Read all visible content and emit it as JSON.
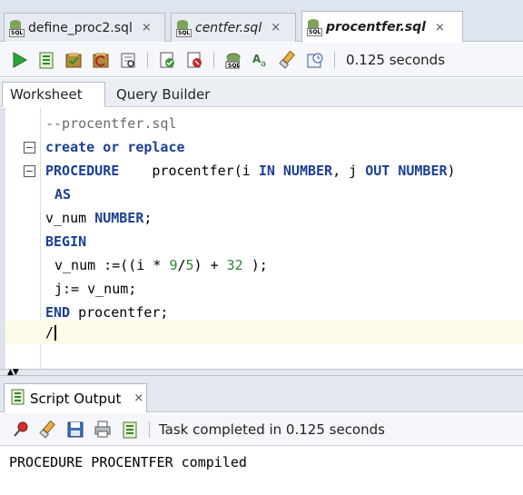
{
  "editor_tabs": [
    {
      "label": "define_proc2.sql",
      "style": "normal",
      "close": "×"
    },
    {
      "label": "centfer.sql",
      "style": "italic",
      "close": "×"
    },
    {
      "label": "procentfer.sql",
      "style": "bold-italic",
      "close": "×",
      "active": true
    }
  ],
  "toolbar": {
    "buttons": [
      "run-statement-icon",
      "run-script-icon",
      "commit-icon",
      "rollback-icon",
      "autotrace-icon",
      "explain-plan-icon",
      "sql-tuning-icon",
      "unshared-sql-icon",
      "format-icon",
      "clear-icon",
      "history-icon"
    ],
    "status": "0.125 seconds"
  },
  "worksheet_tabs": [
    {
      "label": "Worksheet",
      "active": true
    },
    {
      "label": "Query Builder",
      "active": false
    }
  ],
  "code": {
    "l1": "--procentfer.sql",
    "l2_kw1": "create",
    "l2_kw2": "or",
    "l2_kw3": "replace",
    "l3_kw": "PROCEDURE",
    "l3_name": "procentfer(i ",
    "l3_in": "IN",
    "l3_type1": "NUMBER",
    "l3_mid": ", j ",
    "l3_out": "OUT",
    "l3_type2": "NUMBER",
    "l3_end": ")",
    "l4_kw": "AS",
    "l5_var": "v_num ",
    "l5_type": "NUMBER",
    "l5_end": ";",
    "l6_kw": "BEGIN",
    "l7_a": "v_num :=((i * ",
    "l7_n1": "9",
    "l7_b": "/",
    "l7_n2": "5",
    "l7_c": ") + ",
    "l7_n3": "32",
    "l7_d": " );",
    "l8": "j:= v_num;",
    "l9_kw": "END",
    "l9_rest": " procentfer;",
    "l10": "/"
  },
  "output_panel": {
    "tab_label": "Script Output",
    "close": "×",
    "buttons": [
      "pin-icon",
      "clear-output-icon",
      "save-icon",
      "print-icon",
      "run-output-icon"
    ],
    "status": "Task completed in 0.125 seconds",
    "text": "PROCEDURE PROCENTFER compiled"
  },
  "colors": {
    "keyword": "#1b3f93",
    "number": "#2f8a2f",
    "comment": "#6a6a6a",
    "current_line": "#fdfbe7"
  }
}
